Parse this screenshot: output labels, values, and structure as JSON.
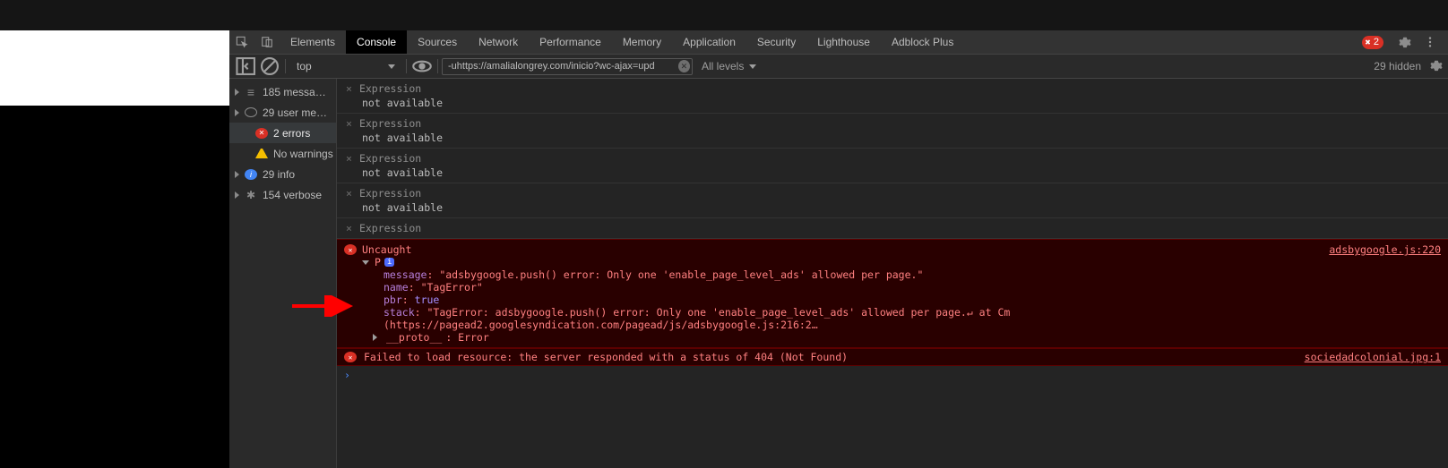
{
  "tabs": {
    "items": [
      "Elements",
      "Console",
      "Sources",
      "Network",
      "Performance",
      "Memory",
      "Application",
      "Security",
      "Lighthouse",
      "Adblock Plus"
    ],
    "active": "Console",
    "error_badge": "2"
  },
  "toolbar": {
    "context": "top",
    "filter_value": "-uhttps://amalialongrey.com/inicio?wc-ajax=upd",
    "levels": "All levels",
    "hidden": "29 hidden"
  },
  "sidebar": {
    "items": [
      {
        "label": "185 messa…",
        "icon": "list",
        "indent": false,
        "selected": false,
        "hasTri": true
      },
      {
        "label": "29 user me…",
        "icon": "user",
        "indent": false,
        "selected": false,
        "hasTri": true
      },
      {
        "label": "2 errors",
        "icon": "error",
        "indent": true,
        "selected": true,
        "hasTri": false
      },
      {
        "label": "No warnings",
        "icon": "warn",
        "indent": true,
        "selected": false,
        "hasTri": false
      },
      {
        "label": "29 info",
        "icon": "info",
        "indent": false,
        "selected": false,
        "hasTri": true
      },
      {
        "label": "154 verbose",
        "icon": "verbose",
        "indent": false,
        "selected": false,
        "hasTri": true
      }
    ]
  },
  "expressions": [
    {
      "title": "Expression",
      "value": "not available"
    },
    {
      "title": "Expression",
      "value": "not available"
    },
    {
      "title": "Expression",
      "value": "not available"
    },
    {
      "title": "Expression",
      "value": "not available"
    },
    {
      "title": "Expression",
      "value": ""
    }
  ],
  "error": {
    "head": "Uncaught",
    "source": "adsbygoogle.js:220",
    "class": "P",
    "props": {
      "message_key": "message",
      "message_val": "\"adsbygoogle.push() error: Only one 'enable_page_level_ads' allowed per page.\"",
      "name_key": "name",
      "name_val": "\"TagError\"",
      "pbr_key": "pbr",
      "pbr_val": "true",
      "stack_key": "stack",
      "stack_val": "\"TagError: adsbygoogle.push() error: Only one 'enable_page_level_ads' allowed per page.↵    at Cm (https://pagead2.googlesyndication.com/pagead/js/adsbygoogle.js:216:2…",
      "proto_key": "__proto__",
      "proto_val": "Error"
    }
  },
  "err404": {
    "msg": "Failed to load resource: the server responded with a status of 404 (Not Found)",
    "source": "sociedadcolonial.jpg:1"
  },
  "prompt": "›"
}
